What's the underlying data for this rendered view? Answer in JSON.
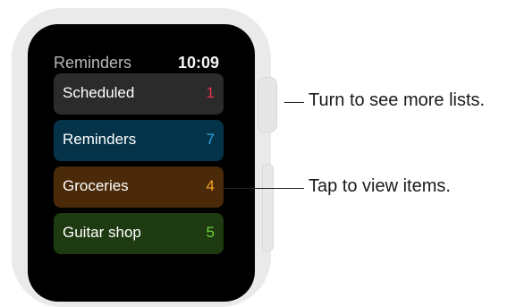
{
  "header": {
    "title": "Reminders",
    "time": "10:09"
  },
  "lists": [
    {
      "label": "Scheduled",
      "count": "1"
    },
    {
      "label": "Reminders",
      "count": "7"
    },
    {
      "label": "Groceries",
      "count": "4"
    },
    {
      "label": "Guitar shop",
      "count": "5"
    }
  ],
  "callouts": {
    "crown": "Turn to see more lists.",
    "tap": "Tap to view items."
  },
  "colors": {
    "scheduled_bg": "#2b2b2b",
    "scheduled_count": "#e5334f",
    "reminders_bg": "#05334a",
    "reminders_count": "#2ea4e0",
    "groceries_bg": "#4a2a08",
    "groceries_count": "#f5a623",
    "guitar_bg": "#1d3a10",
    "guitar_count": "#6fd13a"
  },
  "icons": {
    "crown": "digital-crown",
    "side_button": "side-button"
  }
}
